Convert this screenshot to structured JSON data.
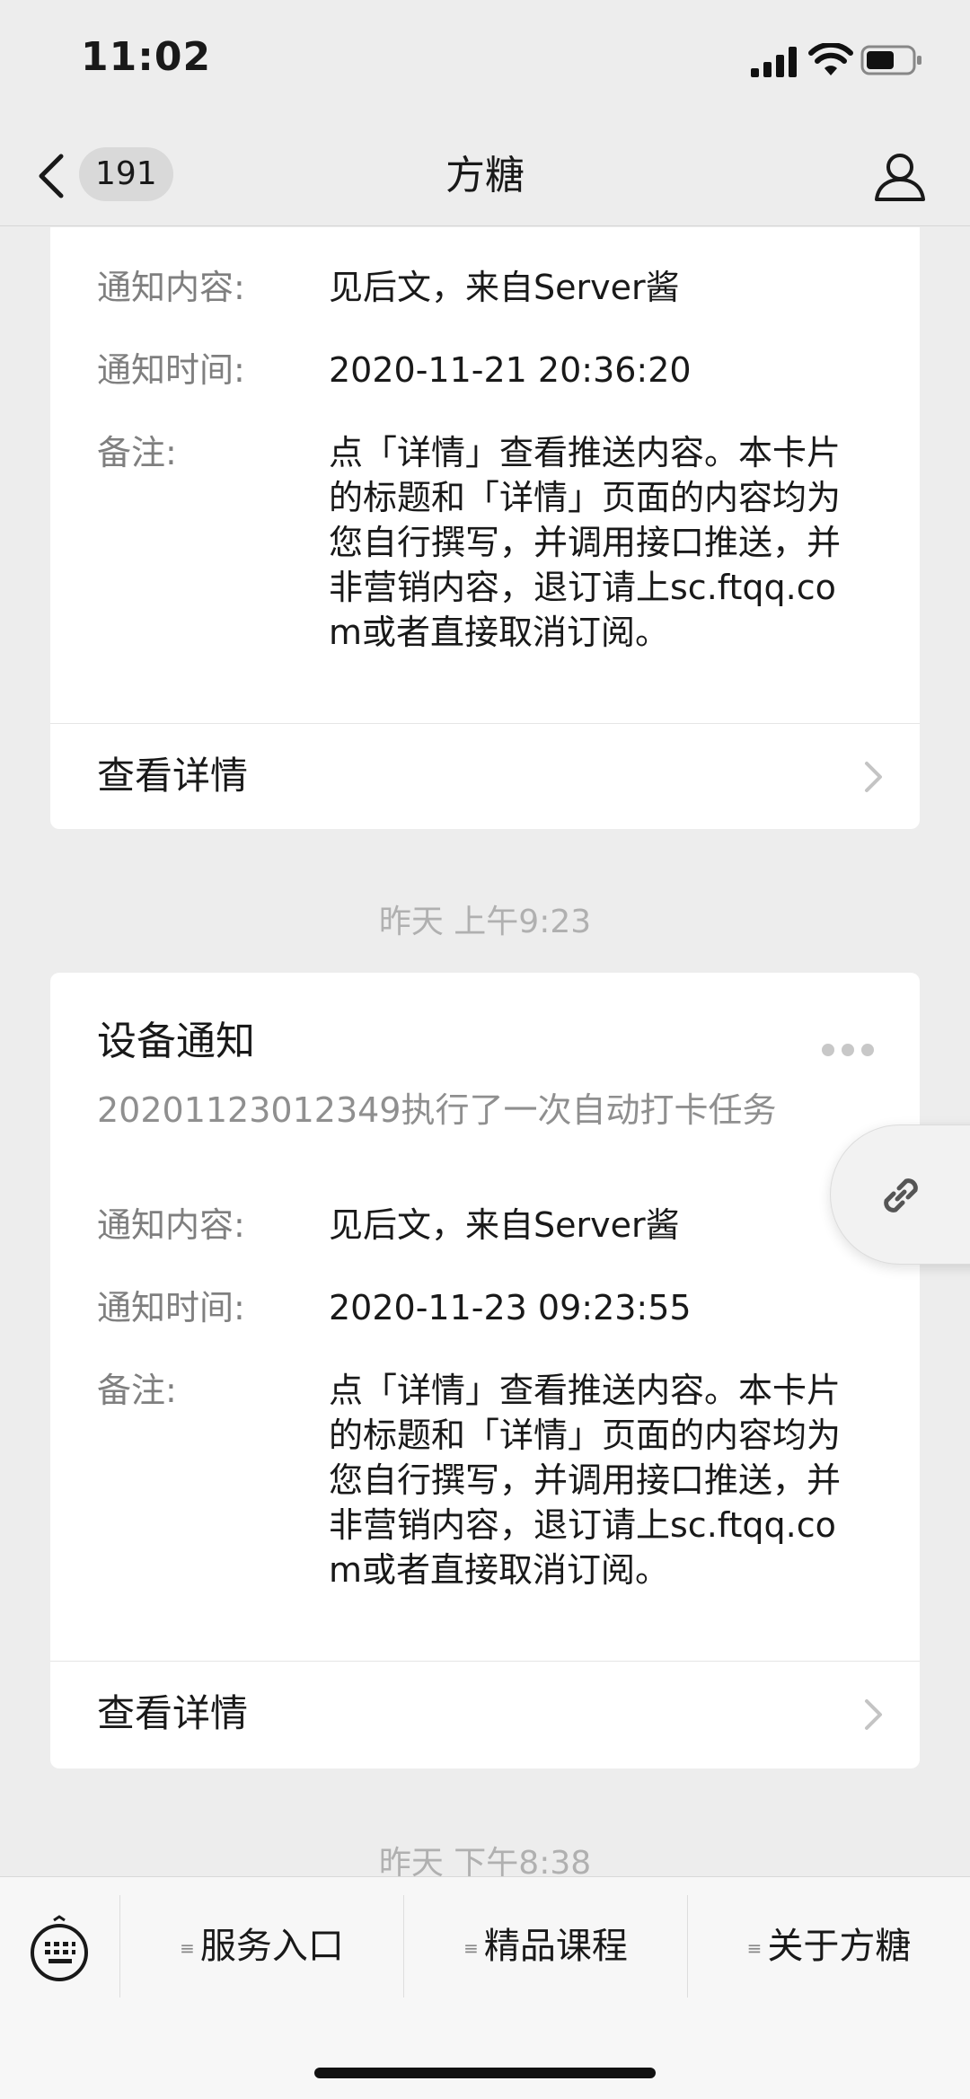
{
  "status_bar": {
    "time": "11:02"
  },
  "nav": {
    "badge": "191",
    "title": "方糖"
  },
  "cards": [
    {
      "rows": [
        {
          "label": "通知内容:",
          "value": "见后文，来自Server酱"
        },
        {
          "label": "通知时间:",
          "value": "2020-11-21 20:36:20"
        },
        {
          "label": "备注:",
          "value": "点「详情」查看推送内容。本卡片的标题和「详情」页面的内容均为您自行撰写，并调用接口推送，并非营销内容，退订请上sc.ftqq.com或者直接取消订阅。"
        }
      ],
      "more_label": "查看详情"
    },
    {
      "title": "设备通知",
      "subtitle": "20201123012349执行了一次自动打卡任务",
      "rows": [
        {
          "label": "通知内容:",
          "value": "见后文，来自Server酱"
        },
        {
          "label": "通知时间:",
          "value": "2020-11-23 09:23:55"
        },
        {
          "label": "备注:",
          "value": "点「详情」查看推送内容。本卡片的标题和「详情」页面的内容均为您自行撰写，并调用接口推送，并非营销内容，退订请上sc.ftqq.com或者直接取消订阅。"
        }
      ],
      "more_label": "查看详情"
    }
  ],
  "timestamps": [
    "昨天 上午9:23",
    "昨天 下午8:38"
  ],
  "menu": {
    "items": [
      "服务入口",
      "精品课程",
      "关于方糖"
    ],
    "item_icon": "≡"
  },
  "icons": [
    "back-icon",
    "user-icon",
    "more-dots-icon",
    "link-icon",
    "keyboard-icon",
    "chevron-right-icon"
  ]
}
